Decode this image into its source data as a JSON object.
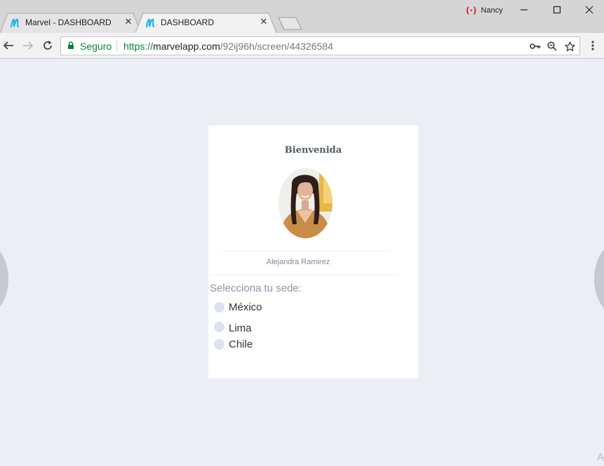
{
  "browser": {
    "tabs": [
      {
        "title": "Marvel - DASHBOARD",
        "favicon": "marvel-icon",
        "active": false
      },
      {
        "title": "DASHBOARD",
        "favicon": "marvel-icon",
        "active": true
      }
    ],
    "close_glyph": "✕",
    "user": {
      "name": "Nancy",
      "icon_glyph": "(·)"
    },
    "address": {
      "secure_label": "Seguro",
      "url_scheme": "https://",
      "url_host": "marvelapp.com",
      "url_path": "/92ij96h/screen/44326584"
    },
    "colors": {
      "secure": "#0b8043",
      "favicon": "#1fb6e8"
    }
  },
  "page": {
    "welcome": "Bienvenida",
    "user_name": "Alejandra Ramirez",
    "prompt": "Selecciona tu sede:",
    "locations": [
      {
        "label": "México",
        "selected": false
      },
      {
        "label": "Lima",
        "selected": false
      },
      {
        "label": "Chile",
        "selected": false
      }
    ],
    "corner_glyph": "A"
  }
}
